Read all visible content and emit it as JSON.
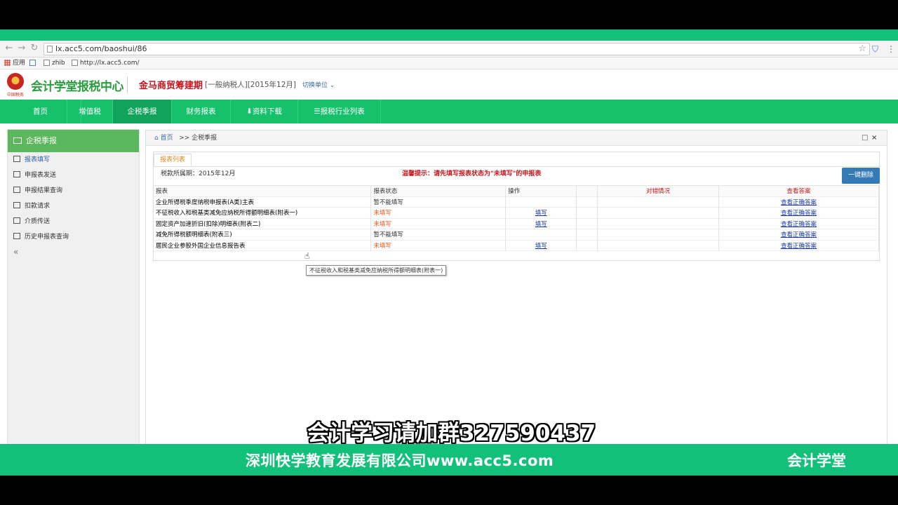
{
  "browser": {
    "url": "lx.acc5.com/baoshui/86",
    "bookmarks": [
      "应用",
      "zhib",
      "http://lx.acc5.com/"
    ]
  },
  "header": {
    "logo_text": "会计学堂报税中心",
    "emblem_text": "中国税务",
    "company": "金马商贸筹建期",
    "tax_type": "[一般纳税人][2015年12月]",
    "switch_label": "切换单位"
  },
  "nav": {
    "items": [
      {
        "label": "首页"
      },
      {
        "label": "增值税"
      },
      {
        "label": "企税季报"
      },
      {
        "label": "财务报表"
      },
      {
        "label": "资料下载"
      },
      {
        "label": "报税行业列表"
      }
    ],
    "active": "企税季报"
  },
  "sidebar": {
    "title": "企税季报",
    "items": [
      {
        "label": "报表填写"
      },
      {
        "label": "申报表发送"
      },
      {
        "label": "申报结果查询"
      },
      {
        "label": "扣款请求"
      },
      {
        "label": "介质传送"
      },
      {
        "label": "历史申报表查询"
      }
    ],
    "collapse": "«"
  },
  "panel": {
    "breadcrumb_home": "首页",
    "breadcrumb_current": ">> 企税季报",
    "tab_label": "报表列表",
    "period": "税款所属期：2015年12月",
    "tip": "温馨提示：请先填写报表状态为\"未填写\"的申报表",
    "delete_all_button": "一键删除",
    "columns": [
      "报表",
      "报表状态",
      "操作",
      "",
      "对错情况",
      "查看答案"
    ],
    "rows": [
      {
        "name": "企业所得税季度纳税申报表(A类)主表",
        "status": "暂不能填写",
        "status_kind": "na",
        "op": "",
        "answer": "查看正确答案"
      },
      {
        "name": "不征税收入和税基类减免应纳税所得额明细表(附表一)",
        "status": "未填写",
        "status_kind": "no",
        "op": "填写",
        "answer": "查看正确答案"
      },
      {
        "name": "固定资产加速折旧(扣除)明细表(附表二)",
        "status": "未填写",
        "status_kind": "no",
        "op": "填写",
        "answer": "查看正确答案"
      },
      {
        "name": "减免所得税额明细表(附表三)",
        "status": "暂不能填写",
        "status_kind": "na",
        "op": "",
        "answer": "查看正确答案"
      },
      {
        "name": "居民企业参股外国企业信息报告表",
        "status": "未填写",
        "status_kind": "no",
        "op": "填写",
        "answer": "查看正确答案"
      }
    ],
    "tooltip": "不征税收入和税基类减免应纳税所得额明细表(附表一)"
  },
  "overlay": {
    "caption": "会计学习请加群327590437",
    "company_line": "深圳快学教育发展有限公司www.acc5.com",
    "brand": "会计学堂"
  }
}
